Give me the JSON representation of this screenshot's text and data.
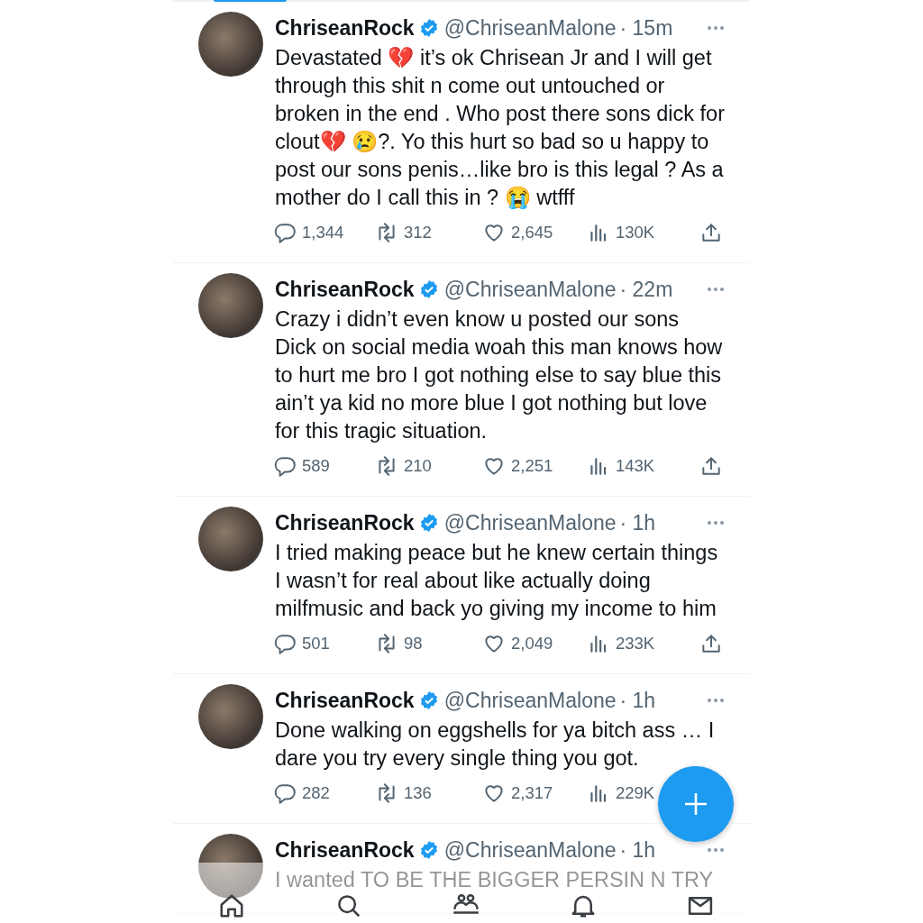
{
  "tweets": [
    {
      "name": "ChriseanRock",
      "verified": true,
      "handle": "@ChriseanMalone",
      "time": "· 15m",
      "text": "Devastated 💔  it’s ok Chrisean Jr and I will get through this shit n come out untouched or broken  in the end . Who post there sons dick for clout💔 😢?. Yo this hurt so bad so u happy to post our sons penis…like bro is this legal ? As a mother do I call this in ? 😭  wtfff",
      "replies": "1,344",
      "retweets": "312",
      "likes": "2,645",
      "views": "130K",
      "share": true
    },
    {
      "name": "ChriseanRock",
      "verified": true,
      "handle": "@ChriseanMalone",
      "time": "· 22m",
      "text": "Crazy i didn’t even know u posted our sons Dick on social media woah this man knows how to hurt me bro I got nothing else to say blue this ain’t ya kid no more blue I got nothing but love for this tragic situation.",
      "replies": "589",
      "retweets": "210",
      "likes": "2,251",
      "views": "143K",
      "share": true
    },
    {
      "name": "ChriseanRock",
      "verified": true,
      "handle": "@ChriseanMalone",
      "time": "· 1h",
      "text": "I tried making peace but he knew certain things I wasn’t for real about like actually doing milfmusic and back yo giving my income to him",
      "replies": "501",
      "retweets": "98",
      "likes": "2,049",
      "views": "233K",
      "share": true
    },
    {
      "name": "ChriseanRock",
      "verified": true,
      "handle": "@ChriseanMalone",
      "time": "· 1h",
      "text": "Done walking on eggshells for ya bitch ass … I dare you try every single thing you got.",
      "replies": "282",
      "retweets": "136",
      "likes": "2,317",
      "views": "229K"
    },
    {
      "name": "ChriseanRock",
      "verified": true,
      "handle": "@ChriseanMalone",
      "time": "· 1h",
      "text": "I wanted TO BE THE BIGGER PERSIN N TRY"
    }
  ]
}
